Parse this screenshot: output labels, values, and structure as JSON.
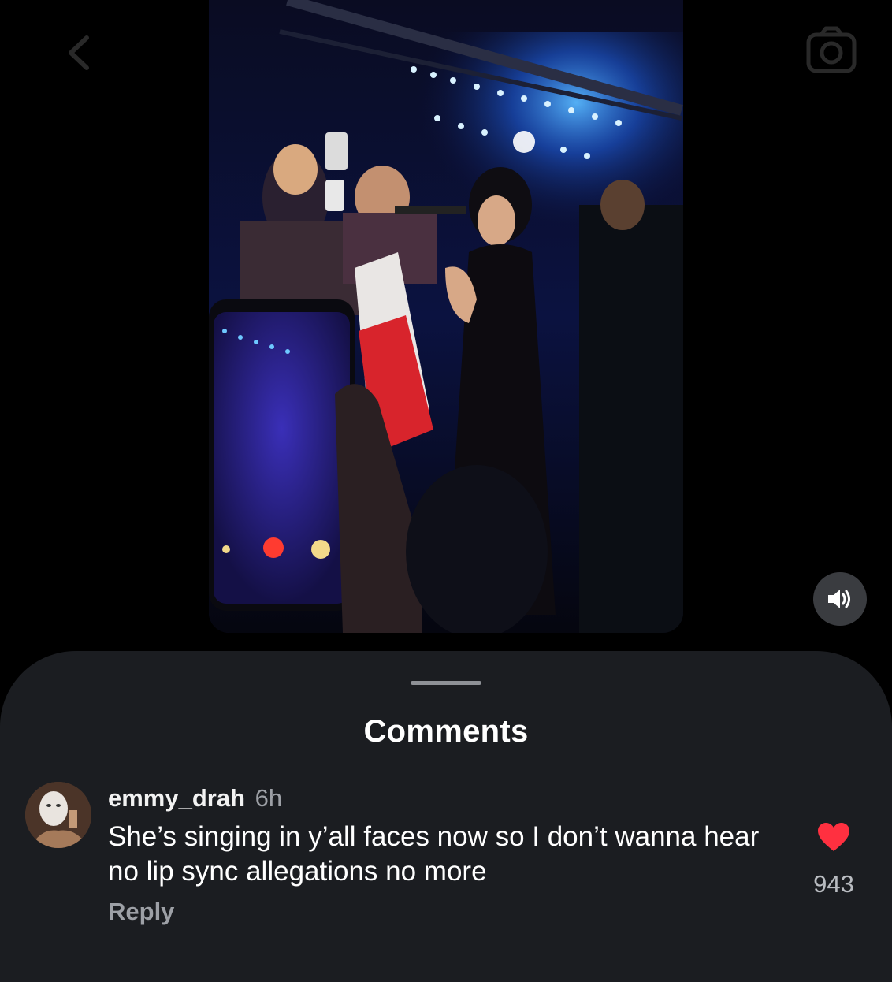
{
  "top": {
    "back_icon": "chevron-left-icon",
    "camera_icon": "camera-icon"
  },
  "video": {
    "sound_icon": "speaker-on-icon"
  },
  "comments_sheet": {
    "title": "Comments",
    "items": [
      {
        "username": "emmy_drah",
        "time": "6h",
        "text": "She’s singing in y’all faces now so I don’t wanna hear no lip sync allegations no more",
        "reply_label": "Reply",
        "likes": "943",
        "liked": true,
        "like_color": "#ff3040"
      }
    ]
  }
}
